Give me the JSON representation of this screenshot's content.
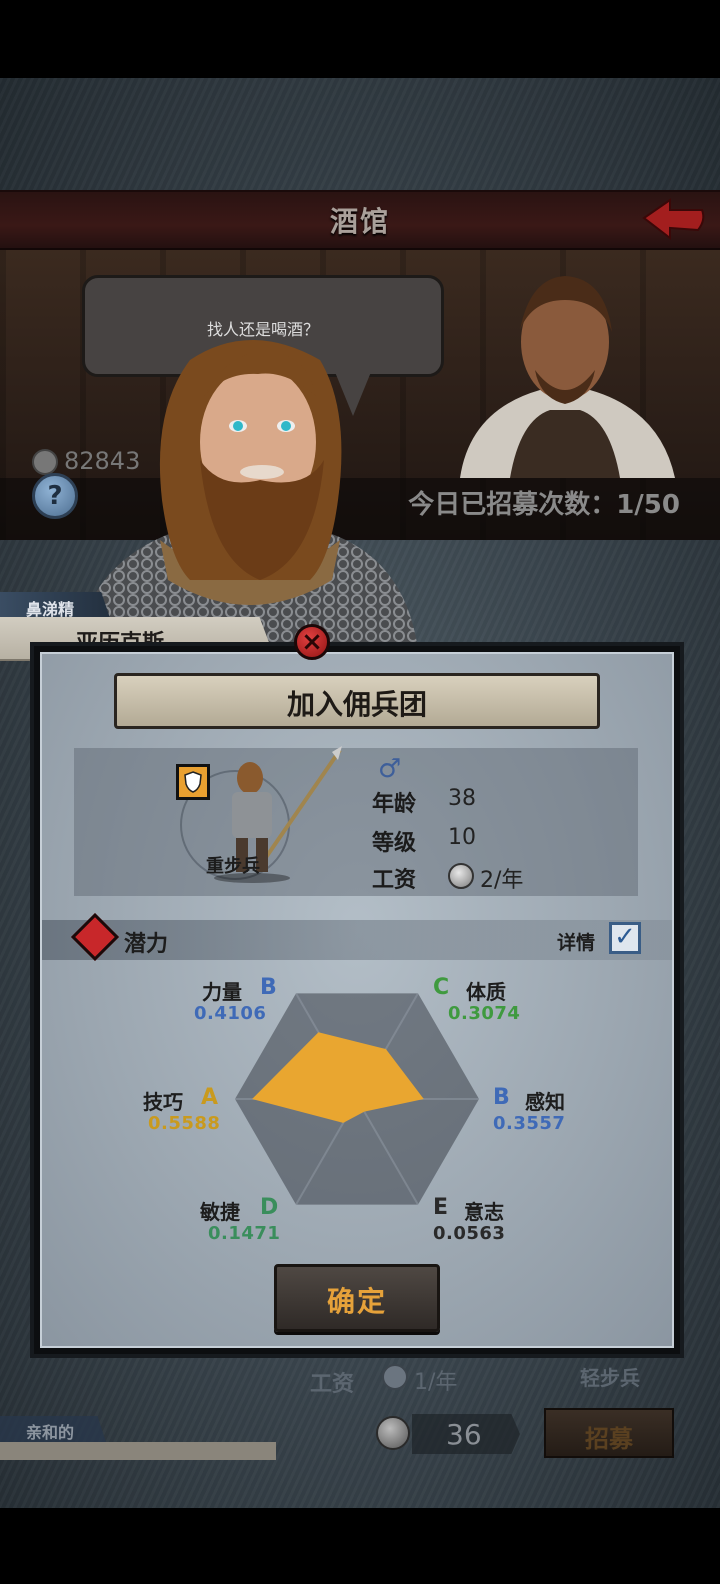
{
  "header": {
    "title": "酒馆"
  },
  "tavern": {
    "dialogue": "找人还是喝酒？",
    "coins": "82843",
    "recruit_count": "今日已招募次数：1/50"
  },
  "mercenary": {
    "nickname": "鼻涕精",
    "name": "亚历克斯",
    "class": "重步兵",
    "gender_symbol": "♂",
    "age_label": "年龄",
    "age": "38",
    "level_label": "等级",
    "level": "10",
    "wage_label": "工资",
    "wage": "2/年"
  },
  "dialog": {
    "title": "加入佣兵团",
    "potential_label": "潜力",
    "detail_label": "详情",
    "detail_checked": true,
    "confirm_label": "确定"
  },
  "attributes": [
    {
      "name": "力量",
      "grade": "B",
      "value": "0.4106",
      "grade_color": "#3f6ab7",
      "value_color": "#3f6ab7"
    },
    {
      "name": "体质",
      "grade": "C",
      "value": "0.3074",
      "grade_color": "#3f9a3f",
      "value_color": "#3f9a3f"
    },
    {
      "name": "感知",
      "grade": "B",
      "value": "0.3557",
      "grade_color": "#3f6ab7",
      "value_color": "#3f6ab7"
    },
    {
      "name": "意志",
      "grade": "E",
      "value": "0.0563",
      "grade_color": "#2a2a2a",
      "value_color": "#2a2a2a"
    },
    {
      "name": "敏捷",
      "grade": "D",
      "value": "0.1471",
      "grade_color": "#3a8e5c",
      "value_color": "#3a8e5c"
    },
    {
      "name": "技巧",
      "grade": "A",
      "value": "0.5588",
      "grade_color": "#c99a1e",
      "value_color": "#c99a1e"
    }
  ],
  "radar_color": "#e9a630",
  "background_list": {
    "wage_label": "工资",
    "wage": "1/年",
    "class": "轻步兵",
    "nickname": "亲和的",
    "cost": "36",
    "recruit_label": "招募"
  }
}
